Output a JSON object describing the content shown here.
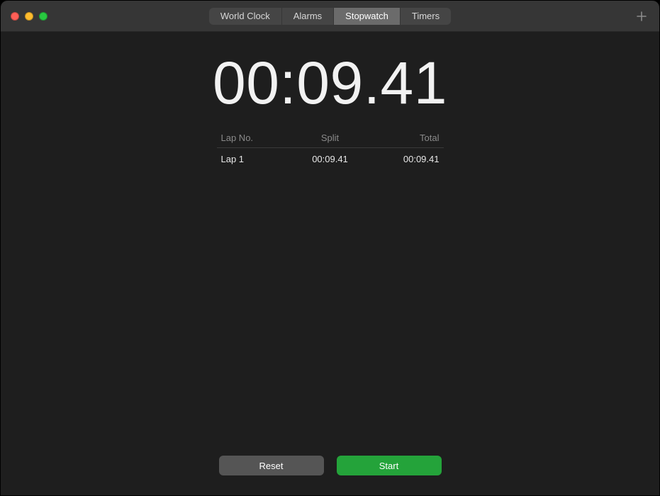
{
  "tabs": [
    {
      "label": "World Clock",
      "selected": false
    },
    {
      "label": "Alarms",
      "selected": false
    },
    {
      "label": "Stopwatch",
      "selected": true
    },
    {
      "label": "Timers",
      "selected": false
    }
  ],
  "time_display": "00:09.41",
  "columns": {
    "lap_no": "Lap No.",
    "split": "Split",
    "total": "Total"
  },
  "laps": [
    {
      "name": "Lap 1",
      "split": "00:09.41",
      "total": "00:09.41"
    }
  ],
  "buttons": {
    "reset": "Reset",
    "start": "Start"
  },
  "colors": {
    "start_button": "#24a33a",
    "reset_button": "#555555",
    "window_bg": "#1e1e1e"
  }
}
